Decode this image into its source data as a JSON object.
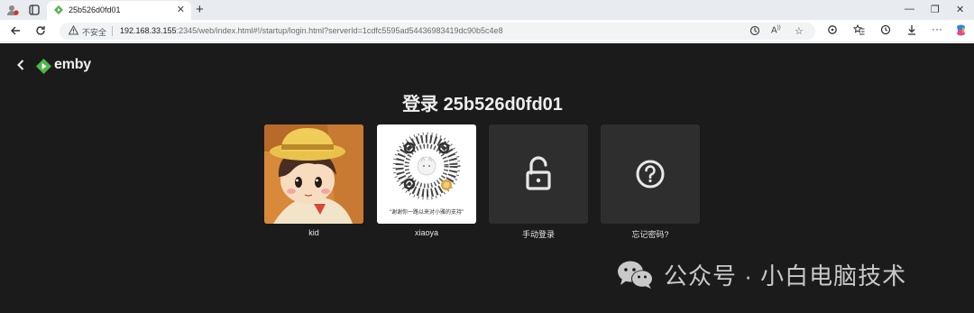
{
  "browser": {
    "tab_title": "25b526d0fd01",
    "tab_close": "✕",
    "new_tab": "+",
    "insecure_label": "不安全",
    "url_host": "192.168.33.155",
    "url_rest": ":2345/web/index.html#!/startup/login.html?serverId=1cdfc5595ad54436983419dc90b5c4e8",
    "window_controls": {
      "minimize": "—",
      "restore": "❐",
      "close": "✕"
    }
  },
  "app": {
    "logo_text": "emby",
    "heading": "登录 25b526d0fd01",
    "brand_green": "#52b54b"
  },
  "users": [
    {
      "label": "kid",
      "type": "avatar"
    },
    {
      "label": "xiaoya",
      "type": "qr",
      "caption": "\"谢谢你一路以来对小雅的支持\""
    },
    {
      "label": "手动登录",
      "type": "manual"
    },
    {
      "label": "忘记密码?",
      "type": "forgot"
    }
  ],
  "watermark": {
    "text": "公众号 · 小白电脑技术"
  }
}
